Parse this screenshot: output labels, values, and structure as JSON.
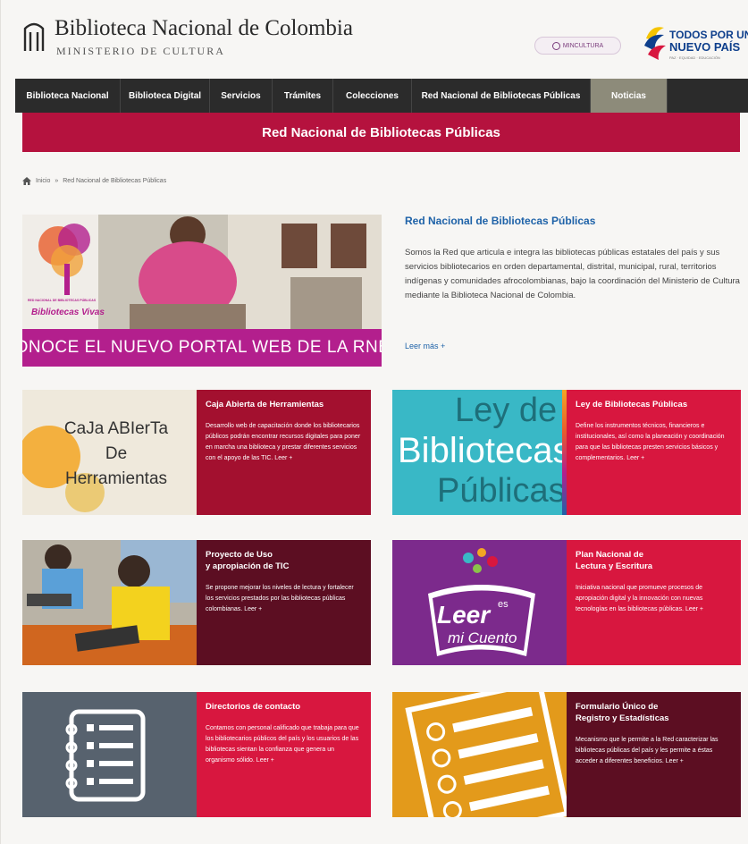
{
  "header": {
    "title": "Biblioteca Nacional de Colombia",
    "subtitle": "MINISTERIO DE CULTURA",
    "mincultura": "MINCULTURA",
    "gov_line1": "TODOS POR UN",
    "gov_line2": "NUEVO PAÍS",
    "gov_small": "PAZ · EQUIDAD · EDUCACIÓN"
  },
  "nav": [
    {
      "label": "Biblioteca Nacional",
      "w": 0
    },
    {
      "label": "Biblioteca Digital"
    },
    {
      "label": "Servicios"
    },
    {
      "label": "Trámites"
    },
    {
      "label": "Colecciones"
    },
    {
      "label": "Red Nacional de Bibliotecas Públicas"
    },
    {
      "label": "Noticias"
    }
  ],
  "banner": "Red Nacional de Bibliotecas Públicas",
  "breadcrumb": {
    "home": "Inicio",
    "sep": "»",
    "current": "Red Nacional de Bibliotecas Públicas"
  },
  "hero": {
    "img_small_label": "RED NACIONAL DE BIBLIOTECAS PÚBLICAS",
    "img_label": "Bibliotecas Vivas",
    "caption": "CONOCE EL NUEVO PORTAL WEB DE LA RNBP",
    "title": "Red Nacional de Bibliotecas Públicas",
    "text": "Somos la Red que articula e integra las bibliotecas públicas estatales del país y sus servicios bibliotecarios en orden departamental, distrital, municipal, rural, territorios indígenas y comunidades afrocolombianas, bajo la coordinación del Ministerio de Cultura mediante la Biblioteca Nacional de Colombia.",
    "more": "Leer más +"
  },
  "cards": [
    {
      "title": "Caja Abierta de Herramientas",
      "text": "Desarrollo web de capacitación donde los bibliotecarios públicos podrán encontrar recursos digitales para poner en marcha una biblioteca y prestar diferentes servicios con el apoyo de las TIC. Leer +",
      "img_text": "CaJa ABIerTa\nDe\nHerramientas",
      "color": "#a3102f"
    },
    {
      "title": "Ley de Bibliotecas Públicas",
      "text": "Define los instrumentos técnicos, financieros e institucionales, así como la planeación y coordinación para que las bibliotecas presten servicios básicos y complementarios. Leer +",
      "img_text1": "Ley de",
      "img_text2": "Bibliotecas",
      "img_text3": "Públicas",
      "color": "#d8173f"
    },
    {
      "title": "Proyecto de Uso\ny apropiación de TIC",
      "text": "Se propone mejorar los niveles de lectura y fortalecer los servicios prestados por las bibliotecas públicas colombianas. Leer +",
      "color": "#5c0e22"
    },
    {
      "title": "Plan Nacional de\nLectura y Escritura",
      "text": "Iniciativa nacional que promueve procesos de apropiación digital y la innovación con nuevas tecnologías en las bibliotecas públicas. Leer +",
      "img_text1": "Leer",
      "img_text2": "es",
      "img_text3": "mi Cuento",
      "color": "#d8173f"
    },
    {
      "title": "Directorios de contacto",
      "text": "Contamos con personal calificado que trabaja para que los bibliotecarios públicos del país y los usuarios de las bibliotecas sientan la confianza que genera un organismo sólido. Leer +",
      "color": "#d8173f"
    },
    {
      "title": "Formulario Único de\nRegistro y Estadísticas",
      "text": "Mecanismo que le permite a la Red caracterizar las bibliotecas públicas del país y les permite a éstas acceder a diferentes beneficios. Leer +",
      "color": "#5c0e22"
    }
  ]
}
